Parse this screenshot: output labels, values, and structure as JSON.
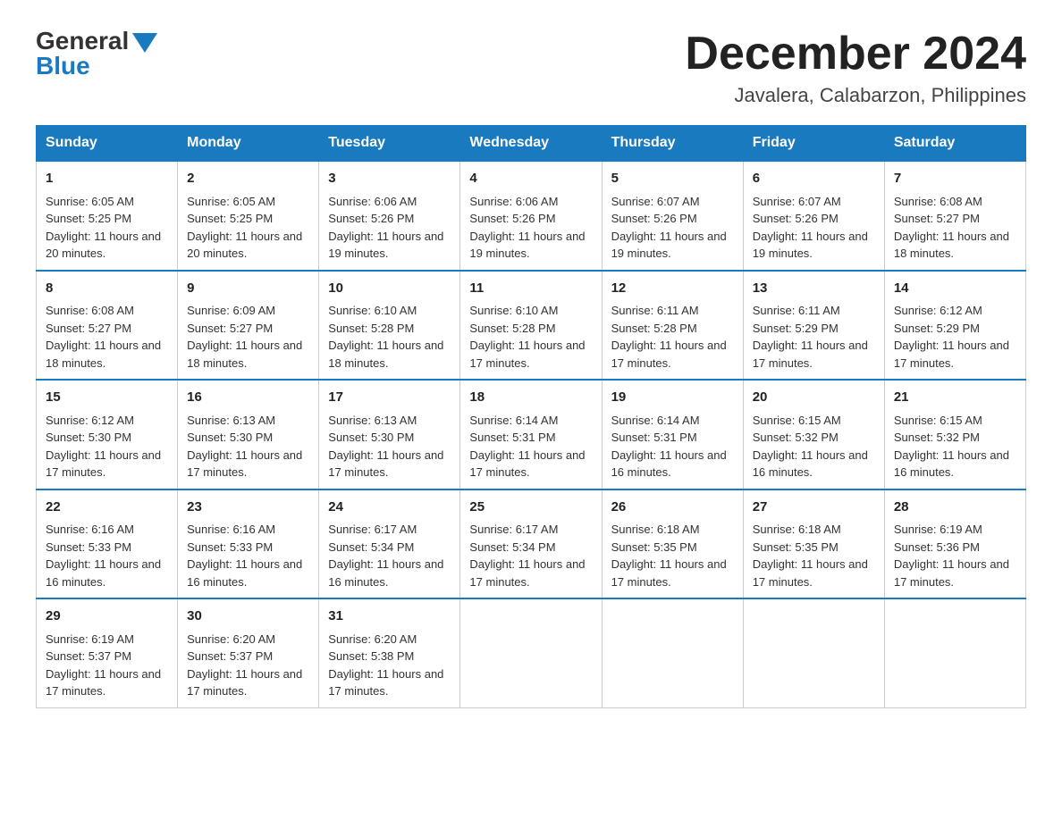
{
  "header": {
    "logo_general": "General",
    "logo_blue": "Blue",
    "month_title": "December 2024",
    "subtitle": "Javalera, Calabarzon, Philippines"
  },
  "days_of_week": [
    "Sunday",
    "Monday",
    "Tuesday",
    "Wednesday",
    "Thursday",
    "Friday",
    "Saturday"
  ],
  "weeks": [
    [
      {
        "day": "1",
        "sunrise": "6:05 AM",
        "sunset": "5:25 PM",
        "daylight": "11 hours and 20 minutes."
      },
      {
        "day": "2",
        "sunrise": "6:05 AM",
        "sunset": "5:25 PM",
        "daylight": "11 hours and 20 minutes."
      },
      {
        "day": "3",
        "sunrise": "6:06 AM",
        "sunset": "5:26 PM",
        "daylight": "11 hours and 19 minutes."
      },
      {
        "day": "4",
        "sunrise": "6:06 AM",
        "sunset": "5:26 PM",
        "daylight": "11 hours and 19 minutes."
      },
      {
        "day": "5",
        "sunrise": "6:07 AM",
        "sunset": "5:26 PM",
        "daylight": "11 hours and 19 minutes."
      },
      {
        "day": "6",
        "sunrise": "6:07 AM",
        "sunset": "5:26 PM",
        "daylight": "11 hours and 19 minutes."
      },
      {
        "day": "7",
        "sunrise": "6:08 AM",
        "sunset": "5:27 PM",
        "daylight": "11 hours and 18 minutes."
      }
    ],
    [
      {
        "day": "8",
        "sunrise": "6:08 AM",
        "sunset": "5:27 PM",
        "daylight": "11 hours and 18 minutes."
      },
      {
        "day": "9",
        "sunrise": "6:09 AM",
        "sunset": "5:27 PM",
        "daylight": "11 hours and 18 minutes."
      },
      {
        "day": "10",
        "sunrise": "6:10 AM",
        "sunset": "5:28 PM",
        "daylight": "11 hours and 18 minutes."
      },
      {
        "day": "11",
        "sunrise": "6:10 AM",
        "sunset": "5:28 PM",
        "daylight": "11 hours and 17 minutes."
      },
      {
        "day": "12",
        "sunrise": "6:11 AM",
        "sunset": "5:28 PM",
        "daylight": "11 hours and 17 minutes."
      },
      {
        "day": "13",
        "sunrise": "6:11 AM",
        "sunset": "5:29 PM",
        "daylight": "11 hours and 17 minutes."
      },
      {
        "day": "14",
        "sunrise": "6:12 AM",
        "sunset": "5:29 PM",
        "daylight": "11 hours and 17 minutes."
      }
    ],
    [
      {
        "day": "15",
        "sunrise": "6:12 AM",
        "sunset": "5:30 PM",
        "daylight": "11 hours and 17 minutes."
      },
      {
        "day": "16",
        "sunrise": "6:13 AM",
        "sunset": "5:30 PM",
        "daylight": "11 hours and 17 minutes."
      },
      {
        "day": "17",
        "sunrise": "6:13 AM",
        "sunset": "5:30 PM",
        "daylight": "11 hours and 17 minutes."
      },
      {
        "day": "18",
        "sunrise": "6:14 AM",
        "sunset": "5:31 PM",
        "daylight": "11 hours and 17 minutes."
      },
      {
        "day": "19",
        "sunrise": "6:14 AM",
        "sunset": "5:31 PM",
        "daylight": "11 hours and 16 minutes."
      },
      {
        "day": "20",
        "sunrise": "6:15 AM",
        "sunset": "5:32 PM",
        "daylight": "11 hours and 16 minutes."
      },
      {
        "day": "21",
        "sunrise": "6:15 AM",
        "sunset": "5:32 PM",
        "daylight": "11 hours and 16 minutes."
      }
    ],
    [
      {
        "day": "22",
        "sunrise": "6:16 AM",
        "sunset": "5:33 PM",
        "daylight": "11 hours and 16 minutes."
      },
      {
        "day": "23",
        "sunrise": "6:16 AM",
        "sunset": "5:33 PM",
        "daylight": "11 hours and 16 minutes."
      },
      {
        "day": "24",
        "sunrise": "6:17 AM",
        "sunset": "5:34 PM",
        "daylight": "11 hours and 16 minutes."
      },
      {
        "day": "25",
        "sunrise": "6:17 AM",
        "sunset": "5:34 PM",
        "daylight": "11 hours and 17 minutes."
      },
      {
        "day": "26",
        "sunrise": "6:18 AM",
        "sunset": "5:35 PM",
        "daylight": "11 hours and 17 minutes."
      },
      {
        "day": "27",
        "sunrise": "6:18 AM",
        "sunset": "5:35 PM",
        "daylight": "11 hours and 17 minutes."
      },
      {
        "day": "28",
        "sunrise": "6:19 AM",
        "sunset": "5:36 PM",
        "daylight": "11 hours and 17 minutes."
      }
    ],
    [
      {
        "day": "29",
        "sunrise": "6:19 AM",
        "sunset": "5:37 PM",
        "daylight": "11 hours and 17 minutes."
      },
      {
        "day": "30",
        "sunrise": "6:20 AM",
        "sunset": "5:37 PM",
        "daylight": "11 hours and 17 minutes."
      },
      {
        "day": "31",
        "sunrise": "6:20 AM",
        "sunset": "5:38 PM",
        "daylight": "11 hours and 17 minutes."
      },
      null,
      null,
      null,
      null
    ]
  ]
}
